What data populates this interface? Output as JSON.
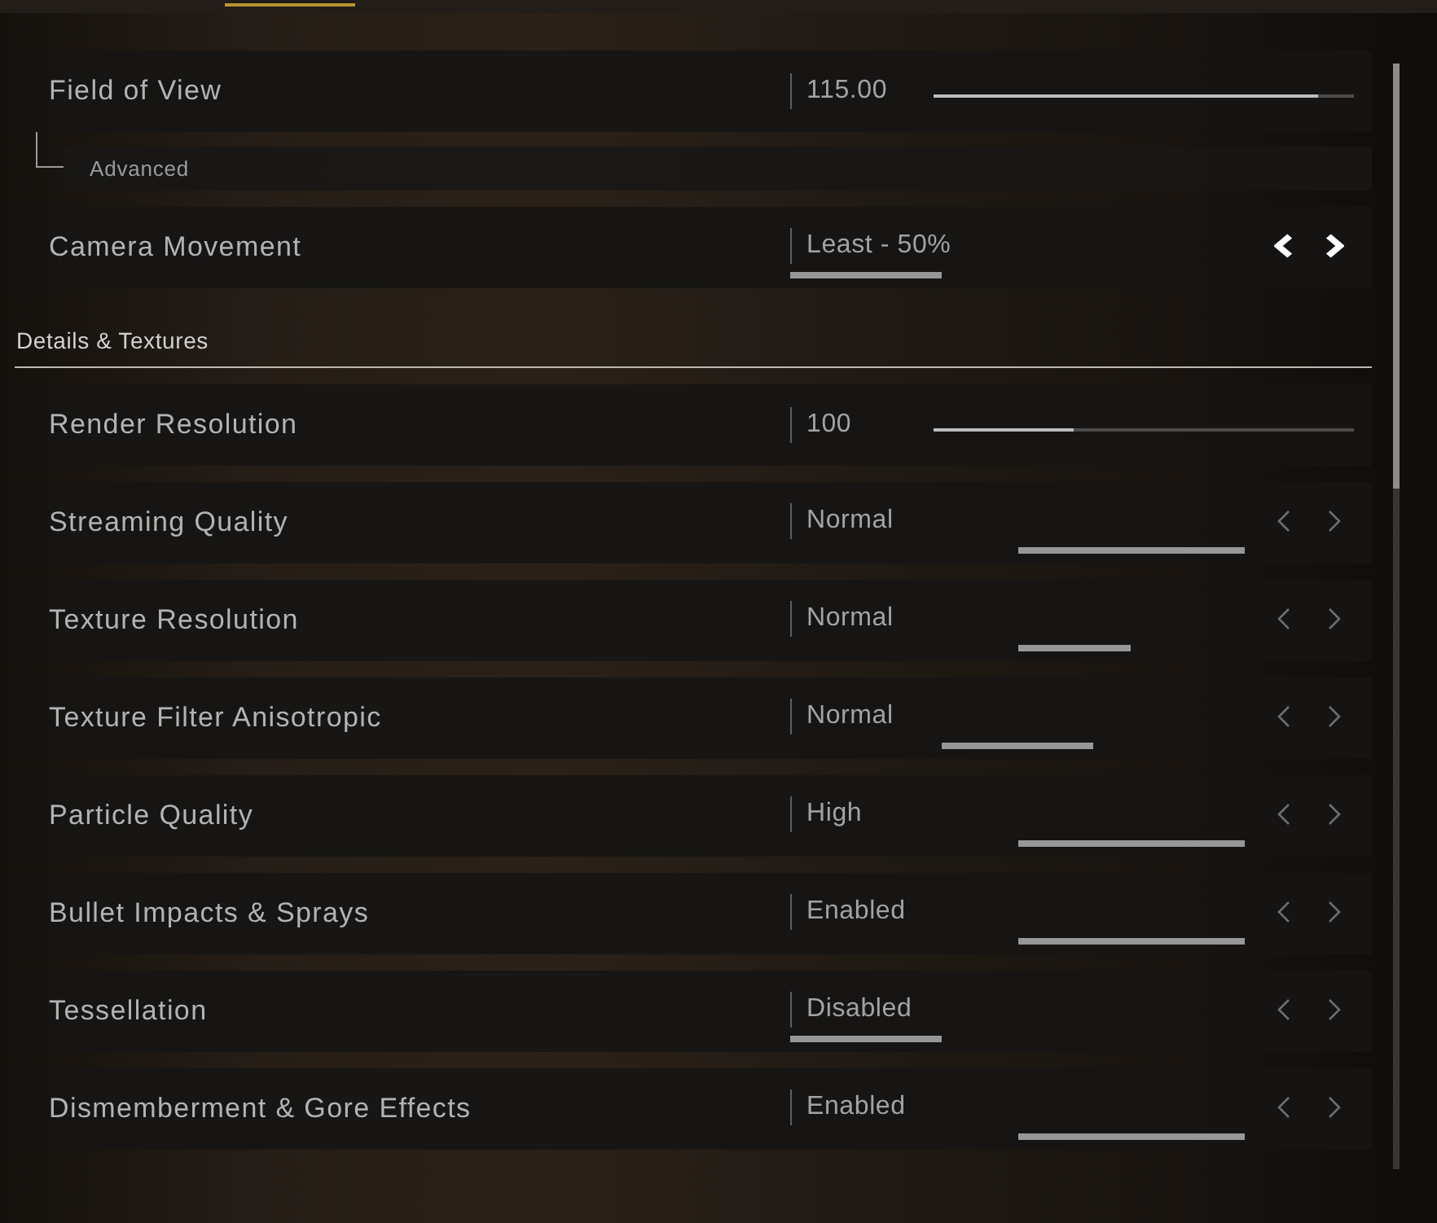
{
  "sections": [
    {
      "rows": [
        {
          "kind": "slider",
          "label": "Field of View",
          "value": "115.00",
          "level": 0.915,
          "highlighted": false,
          "children": [
            {
              "kind": "link",
              "label": "Advanced"
            }
          ]
        },
        {
          "kind": "option",
          "label": "Camera Movement",
          "value": "Least - 50%",
          "highlighted": true,
          "segments": [
            {
              "selected": true
            },
            {
              "selected": false
            },
            {
              "selected": false
            }
          ]
        }
      ]
    },
    {
      "title": "Details & Textures",
      "rows": [
        {
          "kind": "slider",
          "label": "Render Resolution",
          "value": "100",
          "level": 0.333,
          "highlighted": false
        },
        {
          "kind": "option",
          "label": "Streaming Quality",
          "value": "Normal",
          "highlighted": false,
          "segments": [
            {
              "selected": false
            },
            {
              "selected": true
            }
          ]
        },
        {
          "kind": "option",
          "label": "Texture Resolution",
          "value": "Normal",
          "highlighted": false,
          "segments": [
            {
              "selected": false
            },
            {
              "selected": false
            },
            {
              "selected": true
            },
            {
              "selected": false
            }
          ]
        },
        {
          "kind": "option",
          "label": "Texture Filter Anisotropic",
          "value": "Normal",
          "highlighted": false,
          "segments": [
            {
              "selected": false
            },
            {
              "selected": true
            },
            {
              "selected": false
            }
          ]
        },
        {
          "kind": "option",
          "label": "Particle Quality",
          "value": "High",
          "highlighted": false,
          "segments": [
            {
              "selected": false
            },
            {
              "selected": true
            }
          ]
        },
        {
          "kind": "option",
          "label": "Bullet Impacts & Sprays",
          "value": "Enabled",
          "highlighted": false,
          "segments": [
            {
              "selected": false
            },
            {
              "selected": true
            }
          ]
        },
        {
          "kind": "option",
          "label": "Tessellation",
          "value": "Disabled",
          "highlighted": false,
          "segments": [
            {
              "selected": true
            },
            {
              "selected": false
            },
            {
              "selected": false
            }
          ]
        },
        {
          "kind": "option",
          "label": "Dismemberment & Gore Effects",
          "value": "Enabled",
          "highlighted": false,
          "segments": [
            {
              "selected": false
            },
            {
              "selected": true
            }
          ]
        }
      ]
    }
  ]
}
